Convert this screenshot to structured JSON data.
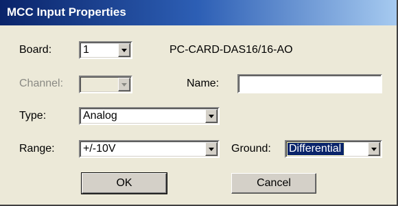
{
  "window": {
    "title": "MCC Input Properties"
  },
  "board": {
    "label": "Board:",
    "value": "1",
    "device_name": "PC-CARD-DAS16/16-AO"
  },
  "channel": {
    "label": "Channel:",
    "value": ""
  },
  "name": {
    "label": "Name:",
    "value": ""
  },
  "type": {
    "label": "Type:",
    "value": "Analog"
  },
  "range": {
    "label": "Range:",
    "value": "+/-10V"
  },
  "ground": {
    "label": "Ground:",
    "value": "Differential"
  },
  "buttons": {
    "ok": "OK",
    "cancel": "Cancel"
  },
  "colors": {
    "titlebar_start": "#0a246a",
    "titlebar_end": "#a6caf0",
    "dialog_bg": "#ece9d8",
    "selection": "#0a246a"
  },
  "icons": {
    "dropdown": "chevron-down-icon"
  }
}
